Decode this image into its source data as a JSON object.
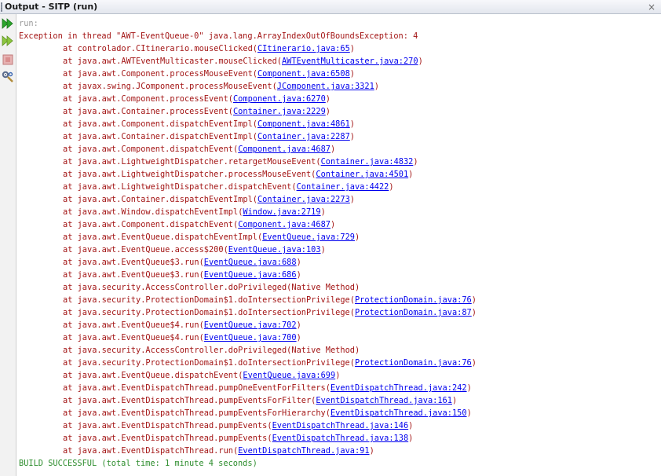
{
  "window": {
    "title": "Output - SITP (run)",
    "close_glyph": "×"
  },
  "toolbar": {
    "buttons": [
      {
        "icon": "rerun-icon",
        "color": "#2ca52c"
      },
      {
        "icon": "rerun-with-options-icon",
        "color": "#7bbb2a"
      },
      {
        "icon": "stop-icon",
        "color": "#d98f8f"
      },
      {
        "icon": "settings-icon",
        "color": "#5a6a8a"
      }
    ]
  },
  "output": {
    "run_line": "run:",
    "exception_line": "Exception in thread \"AWT-EventQueue-0\" java.lang.ArrayIndexOutOfBoundsException: 4",
    "frames": [
      {
        "method": "at controlador.CItinerario.mouseClicked",
        "link": "CItinerario.java:65"
      },
      {
        "method": "at java.awt.AWTEventMulticaster.mouseClicked",
        "link": "AWTEventMulticaster.java:270"
      },
      {
        "method": "at java.awt.Component.processMouseEvent",
        "link": "Component.java:6508"
      },
      {
        "method": "at javax.swing.JComponent.processMouseEvent",
        "link": "JComponent.java:3321"
      },
      {
        "method": "at java.awt.Component.processEvent",
        "link": "Component.java:6270"
      },
      {
        "method": "at java.awt.Container.processEvent",
        "link": "Container.java:2229"
      },
      {
        "method": "at java.awt.Component.dispatchEventImpl",
        "link": "Component.java:4861"
      },
      {
        "method": "at java.awt.Container.dispatchEventImpl",
        "link": "Container.java:2287"
      },
      {
        "method": "at java.awt.Component.dispatchEvent",
        "link": "Component.java:4687"
      },
      {
        "method": "at java.awt.LightweightDispatcher.retargetMouseEvent",
        "link": "Container.java:4832"
      },
      {
        "method": "at java.awt.LightweightDispatcher.processMouseEvent",
        "link": "Container.java:4501"
      },
      {
        "method": "at java.awt.LightweightDispatcher.dispatchEvent",
        "link": "Container.java:4422"
      },
      {
        "method": "at java.awt.Container.dispatchEventImpl",
        "link": "Container.java:2273"
      },
      {
        "method": "at java.awt.Window.dispatchEventImpl",
        "link": "Window.java:2719"
      },
      {
        "method": "at java.awt.Component.dispatchEvent",
        "link": "Component.java:4687"
      },
      {
        "method": "at java.awt.EventQueue.dispatchEventImpl",
        "link": "EventQueue.java:729"
      },
      {
        "method": "at java.awt.EventQueue.access$200",
        "link": "EventQueue.java:103"
      },
      {
        "method": "at java.awt.EventQueue$3.run",
        "link": "EventQueue.java:688"
      },
      {
        "method": "at java.awt.EventQueue$3.run",
        "link": "EventQueue.java:686"
      },
      {
        "method": "at java.security.AccessController.doPrivileged",
        "plain": "Native Method"
      },
      {
        "method": "at java.security.ProtectionDomain$1.doIntersectionPrivilege",
        "link": "ProtectionDomain.java:76"
      },
      {
        "method": "at java.security.ProtectionDomain$1.doIntersectionPrivilege",
        "link": "ProtectionDomain.java:87"
      },
      {
        "method": "at java.awt.EventQueue$4.run",
        "link": "EventQueue.java:702"
      },
      {
        "method": "at java.awt.EventQueue$4.run",
        "link": "EventQueue.java:700"
      },
      {
        "method": "at java.security.AccessController.doPrivileged",
        "plain": "Native Method"
      },
      {
        "method": "at java.security.ProtectionDomain$1.doIntersectionPrivilege",
        "link": "ProtectionDomain.java:76"
      },
      {
        "method": "at java.awt.EventQueue.dispatchEvent",
        "link": "EventQueue.java:699"
      },
      {
        "method": "at java.awt.EventDispatchThread.pumpOneEventForFilters",
        "link": "EventDispatchThread.java:242"
      },
      {
        "method": "at java.awt.EventDispatchThread.pumpEventsForFilter",
        "link": "EventDispatchThread.java:161"
      },
      {
        "method": "at java.awt.EventDispatchThread.pumpEventsForHierarchy",
        "link": "EventDispatchThread.java:150"
      },
      {
        "method": "at java.awt.EventDispatchThread.pumpEvents",
        "link": "EventDispatchThread.java:146"
      },
      {
        "method": "at java.awt.EventDispatchThread.pumpEvents",
        "link": "EventDispatchThread.java:138"
      },
      {
        "method": "at java.awt.EventDispatchThread.run",
        "link": "EventDispatchThread.java:91"
      }
    ],
    "build_line": "BUILD SUCCESSFUL (total time: 1 minute 4 seconds)",
    "colors": {
      "error_text": "#a31515",
      "link_text": "#0000ee",
      "run_text": "#999999",
      "success_text": "#2d8d2d"
    }
  }
}
